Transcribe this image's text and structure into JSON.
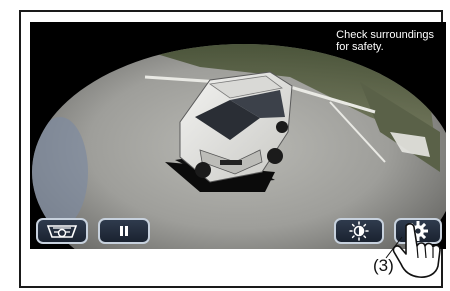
{
  "screen": {
    "notice_text": "Check surroundings\nfor safety."
  },
  "buttons": [
    {
      "id": "view-switch",
      "icon": "car-front-view-icon"
    },
    {
      "id": "pause",
      "icon": "pause-icon"
    },
    {
      "id": "brightness",
      "icon": "brightness-icon"
    },
    {
      "id": "settings",
      "icon": "gear-icon"
    }
  ],
  "callout": {
    "label": "(3)"
  },
  "colors": {
    "screen_bg": "#000000",
    "button_bg": "#232c3a",
    "button_border": "#c7d1dd"
  }
}
